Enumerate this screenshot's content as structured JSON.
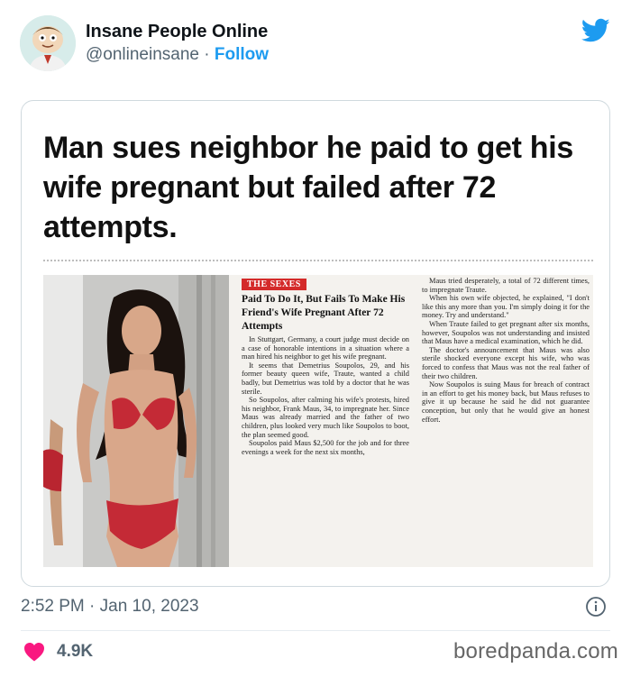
{
  "tweet": {
    "display_name": "Insane People Online",
    "handle": "@onlineinsane",
    "separator": "·",
    "follow_label": "Follow",
    "timestamp": "2:52 PM · Jan 10, 2023",
    "likes": "4.9K"
  },
  "media": {
    "headline": "Man sues neighbor he paid to get his wife pregnant but failed after 72 attempts.",
    "clipping": {
      "tag": "THE SEXES",
      "title": "Paid To Do It, But Fails To Make His Friend's Wife Pregnant After 72 Attempts",
      "col1": [
        "In Stuttgart, Germany, a court judge must decide on a case of honorable intentions in a situation where a man hired his neighbor to get his wife pregnant.",
        "It seems that Demetrius Soupolos, 29, and his former beauty queen wife, Traute, wanted a child badly, but Demetrius was told by a doctor that he was sterile.",
        "So Soupolos, after calming his wife's protests, hired his neighbor, Frank Maus, 34, to impregnate her. Since Maus was already married and the father of two children, plus looked very much like Soupolos to boot, the plan seemed good.",
        "Soupolos paid Maus $2,500 for the job and for three evenings a week for the next six months,"
      ],
      "col2": [
        "Maus tried desperately, a total of 72 different times, to impregnate Traute.",
        "When his own wife objected, he explained, \"I don't like this any more than you. I'm simply doing it for the money. Try and understand.\"",
        "When Traute failed to get pregnant after six months, however, Soupolos was not understanding and insisted that Maus have a medical examination, which he did.",
        "The doctor's announcement that Maus was also sterile shocked everyone except his wife, who was forced to confess that Maus was not the real father of their two children.",
        "Now Soupolos is suing Maus for breach of contract in an effort to get his money back, but Maus refuses to give it up because he said he did not guarantee conception, but only that he would give an honest effort."
      ]
    }
  },
  "watermark": "boredpanda.com",
  "colors": {
    "twitter_blue": "#1d9bf0",
    "heart_red": "#f91880",
    "tag_red": "#d42a2a",
    "muted_text": "#536471"
  },
  "icons": {
    "bird": "twitter-bird-icon",
    "info": "info-icon",
    "heart": "heart-icon"
  }
}
